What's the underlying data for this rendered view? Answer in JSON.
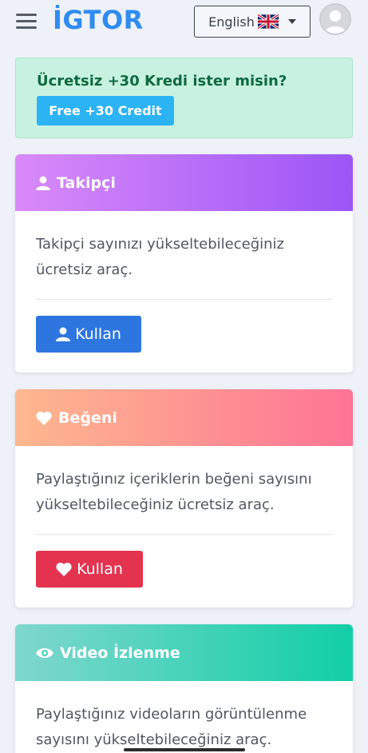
{
  "header": {
    "menu_icon": "hamburger-menu-icon",
    "logo": "İGTOR",
    "language": {
      "label": "English",
      "flag": "uk-flag-icon"
    },
    "avatar_icon": "user-avatar-icon"
  },
  "promo": {
    "title": "Ücretsiz +30 Kredi ister misin?",
    "button": "Free +30 Credit"
  },
  "cards": [
    {
      "title": "Takipçi",
      "icon": "user-icon",
      "description": "Takipçi sayınızı yükseltebileceğiniz ücretsiz araç.",
      "button": "Kullan",
      "button_icon": "user-icon",
      "gradient": [
        "#d98af8",
        "#9c55f7"
      ],
      "button_color": "#2d76e0"
    },
    {
      "title": "Beğeni",
      "icon": "heart-icon",
      "description": "Paylaştığınız içeriklerin beğeni sayısını yükseltebileceğiniz ücretsiz araç.",
      "button": "Kullan",
      "button_icon": "heart-icon",
      "gradient": [
        "#fdb88e",
        "#fe7495"
      ],
      "button_color": "#e3334f"
    },
    {
      "title": "Video İzlenme",
      "icon": "eye-icon",
      "description": "Paylaştığınız videoların görüntülenme sayısını yükseltebileceğiniz araç.",
      "gradient": [
        "#7fd7cd",
        "#11cfa8"
      ]
    }
  ]
}
